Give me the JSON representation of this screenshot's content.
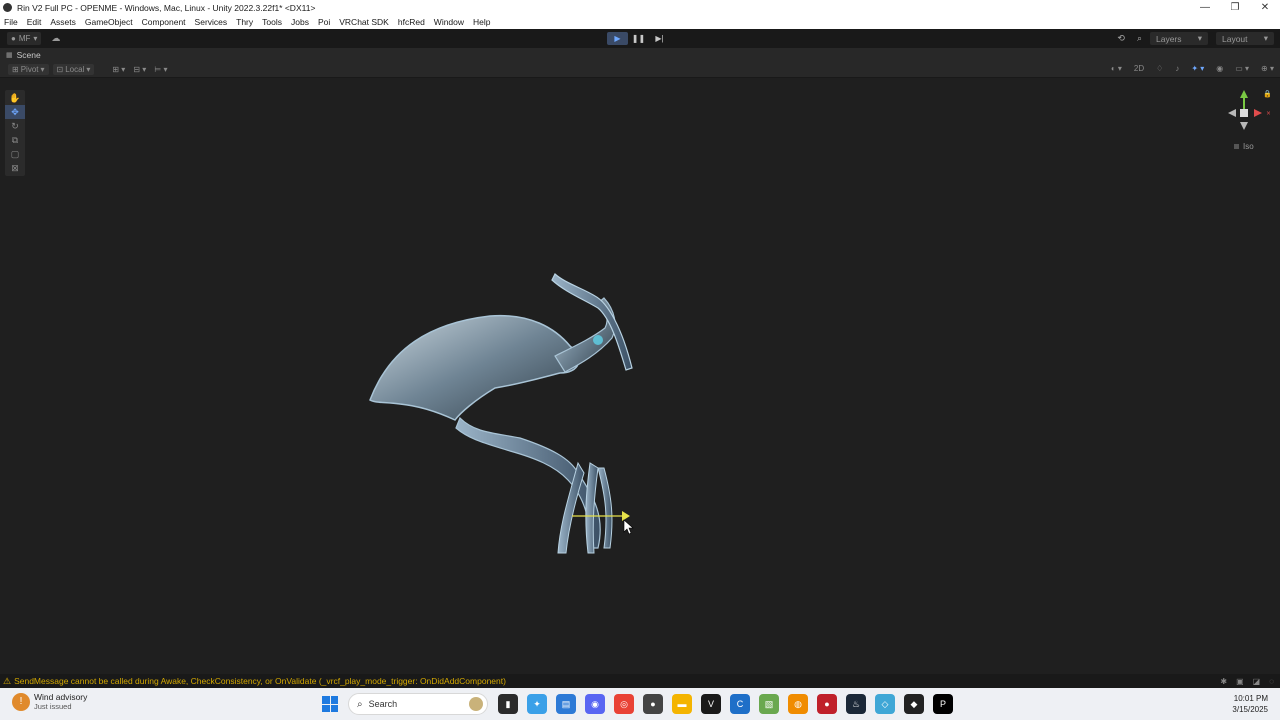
{
  "window": {
    "title": "Rin V2 Full PC - OPENME - Windows, Mac, Linux - Unity 2022.3.22f1* <DX11>",
    "minimize_icon": "minimize-icon",
    "maximize_icon": "restore-icon",
    "close_icon": "close-icon"
  },
  "menu": [
    "File",
    "Edit",
    "Assets",
    "GameObject",
    "Component",
    "Services",
    "Thry",
    "Tools",
    "Jobs",
    "Poi",
    "VRChat SDK",
    "hfcRed",
    "Window",
    "Help"
  ],
  "toolbar": {
    "account": "MF",
    "layers_label": "Layers",
    "layout_label": "Layout"
  },
  "scene": {
    "tab_label": "Scene",
    "pivot_label": "Pivot",
    "local_label": "Local",
    "mode_2d": "2D",
    "iso_label": "Iso"
  },
  "console": {
    "message": "SendMessage cannot be called during Awake, CheckConsistency, or OnValidate (_vrcf_play_mode_trigger: OnDidAddComponent)"
  },
  "taskbar": {
    "weather_title": "Wind advisory",
    "weather_sub": "Just issued",
    "search_placeholder": "Search",
    "time": "10:01 PM",
    "date": "3/15/2025"
  },
  "colors": {
    "accent": "#6fa8ff",
    "warning": "#d4a800",
    "viewport_bg": "#1f1f1f"
  }
}
